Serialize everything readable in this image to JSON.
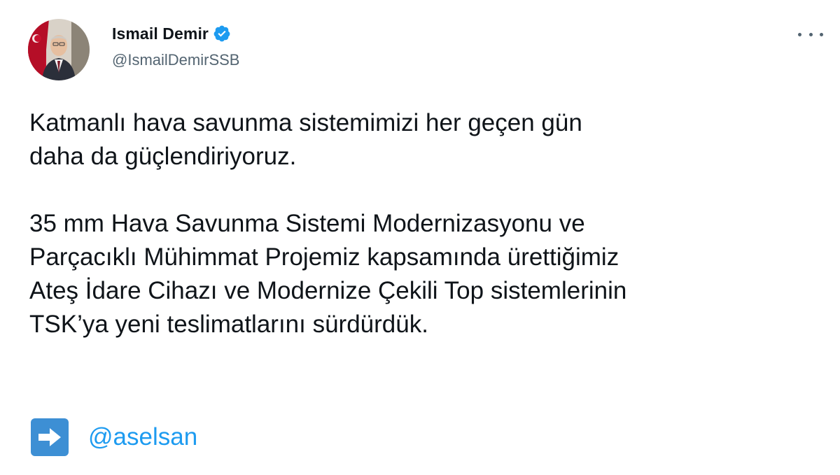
{
  "author": {
    "display_name": "Ismail Demir",
    "handle": "@IsmailDemirSSB",
    "verified": true
  },
  "tweet": {
    "paragraph_1": [
      "Katmanlı hava savunma sistemimizi her geçen gün",
      "daha da güçlendiriyoruz."
    ],
    "paragraph_2": [
      "35 mm Hava Savunma Sistemi Modernizasyonu ve",
      "Parçacıklı Mühimmat Projemiz kapsamında ürettiğimiz",
      "Ateş İdare Cihazı ve Modernize Çekili Top sistemlerinin",
      "TSK’ya yeni teslimatlarını sürdürdük."
    ],
    "mention": "@aselsan"
  },
  "icons": {
    "avatar": "profile-photo",
    "verified": "verified-badge-icon",
    "more": "more-options-icon",
    "arrow": "right-arrow-emoji-icon"
  },
  "colors": {
    "text": "#0f1419",
    "secondary": "#536471",
    "link": "#1d9bf0",
    "verified": "#1d9bf0",
    "arrow_emoji_bg": "#3d8fd4"
  }
}
